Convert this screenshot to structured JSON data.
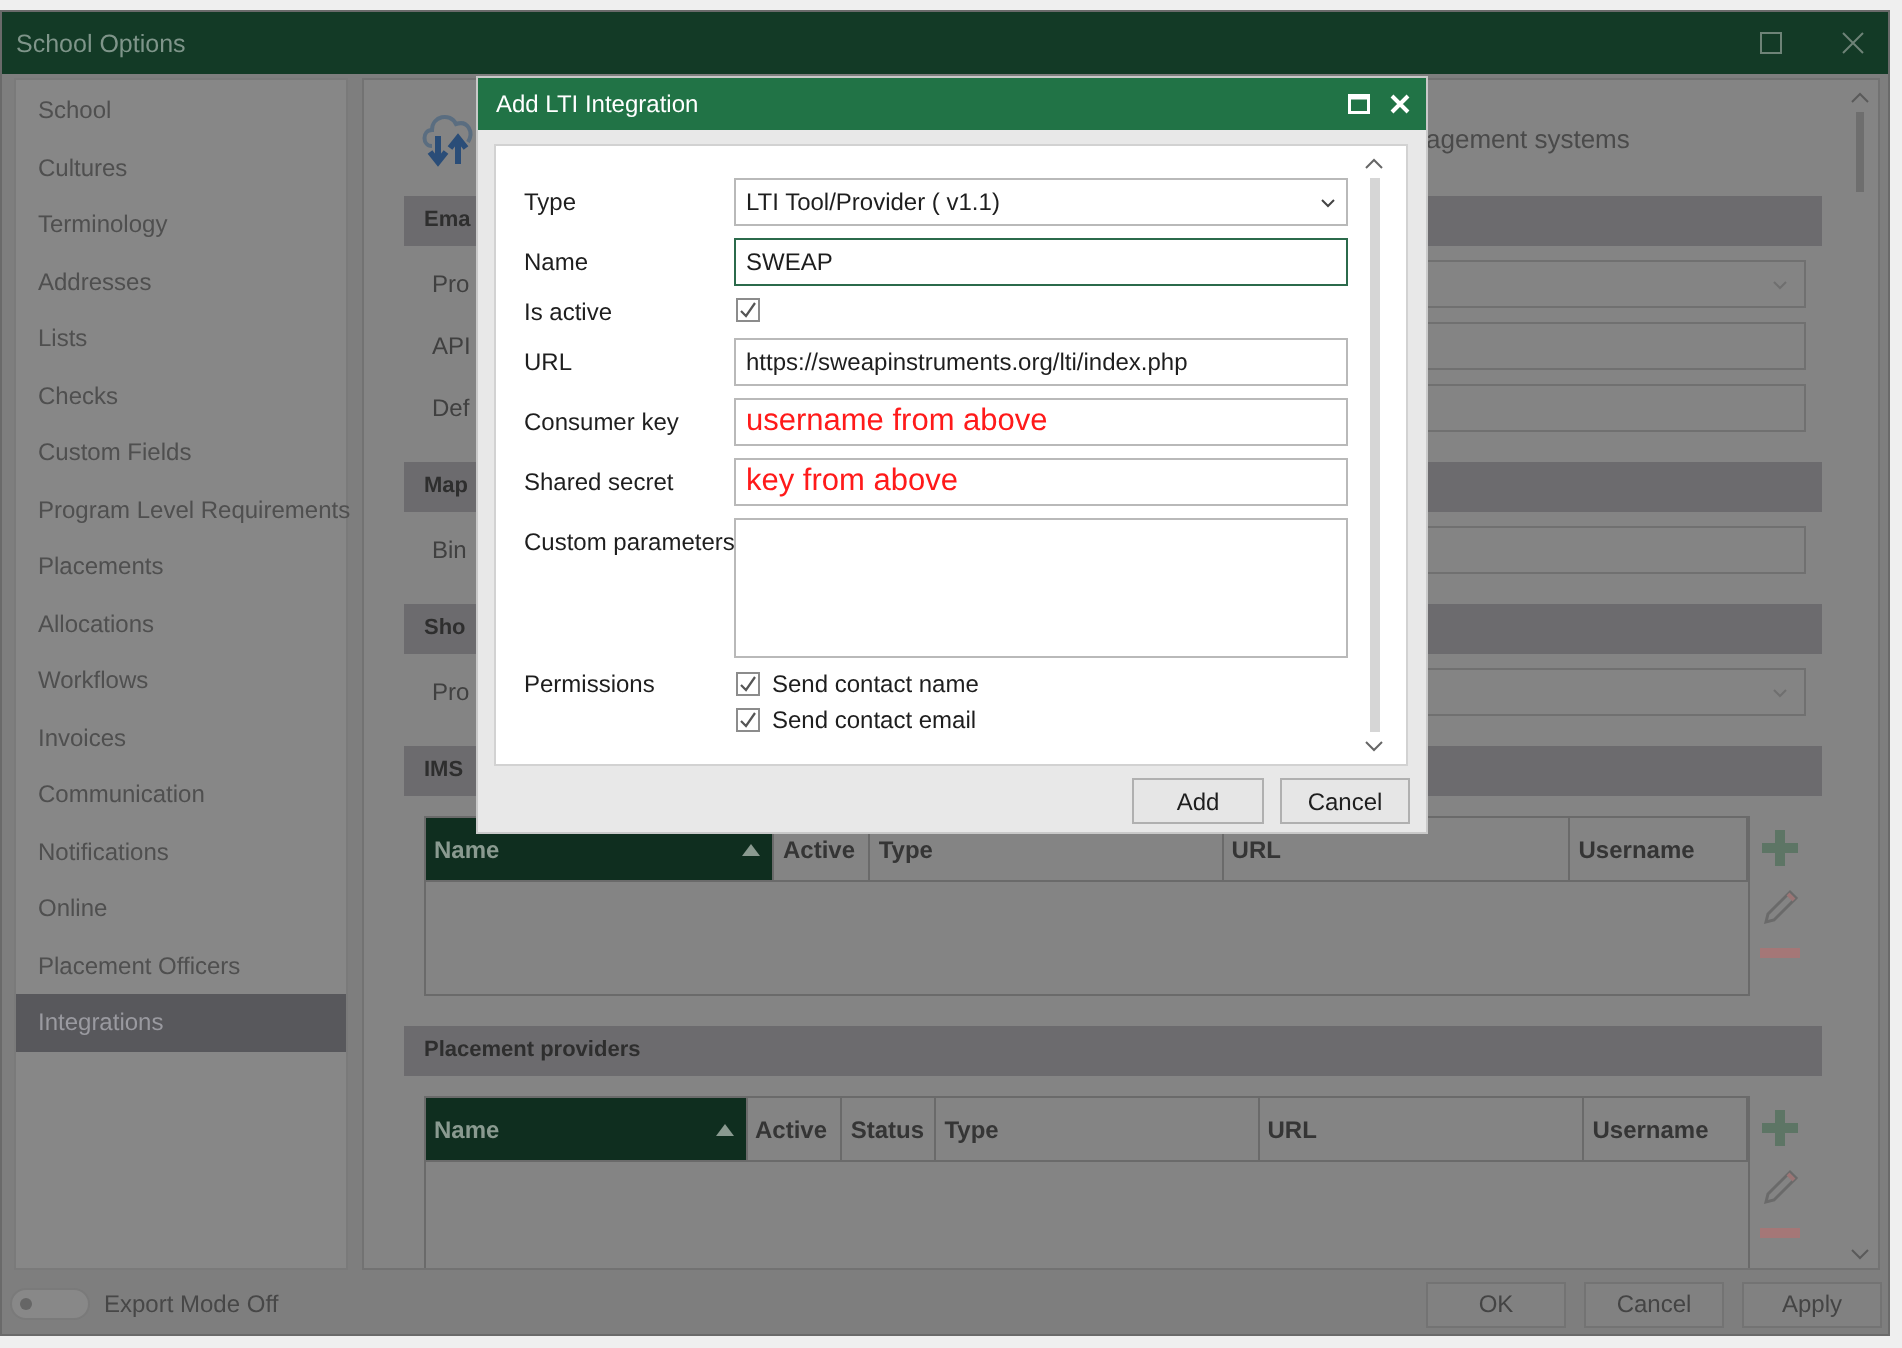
{
  "window": {
    "title": "School Options"
  },
  "sidebar": {
    "items": [
      {
        "label": "School",
        "selected": false
      },
      {
        "label": "Cultures",
        "selected": false
      },
      {
        "label": "Terminology",
        "selected": false
      },
      {
        "label": "Addresses",
        "selected": false
      },
      {
        "label": "Lists",
        "selected": false
      },
      {
        "label": "Checks",
        "selected": false
      },
      {
        "label": "Custom Fields",
        "selected": false
      },
      {
        "label": "Program Level Requirements",
        "selected": false
      },
      {
        "label": "Placements",
        "selected": false
      },
      {
        "label": "Allocations",
        "selected": false
      },
      {
        "label": "Workflows",
        "selected": false
      },
      {
        "label": "Invoices",
        "selected": false
      },
      {
        "label": "Communication",
        "selected": false
      },
      {
        "label": "Notifications",
        "selected": false
      },
      {
        "label": "Online",
        "selected": false
      },
      {
        "label": "Placement Officers",
        "selected": false
      },
      {
        "label": "Integrations",
        "selected": true
      }
    ]
  },
  "content": {
    "heading": "agement systems",
    "blocks": [
      {
        "kind": "section",
        "title": "Ema"
      },
      {
        "kind": "dropdown",
        "label": "Pro"
      },
      {
        "kind": "textfield",
        "label": "API"
      },
      {
        "kind": "textfield",
        "label": "Def"
      },
      {
        "kind": "section",
        "title": "Map"
      },
      {
        "kind": "textfield",
        "label": "Bin"
      },
      {
        "kind": "section",
        "title": "Sho"
      },
      {
        "kind": "dropdown",
        "label": "Pro"
      },
      {
        "kind": "section",
        "title": "IMS"
      },
      {
        "kind": "table",
        "columns": [
          {
            "label": "Name",
            "sorted": true
          },
          {
            "label": "Active",
            "sorted": false
          },
          {
            "label": "Type",
            "sorted": false
          },
          {
            "label": "URL",
            "sorted": false
          },
          {
            "label": "Username",
            "sorted": false
          }
        ]
      },
      {
        "kind": "section",
        "title": "Placement providers"
      },
      {
        "kind": "table",
        "columns": [
          {
            "label": "Name",
            "sorted": true
          },
          {
            "label": "Active",
            "sorted": false
          },
          {
            "label": "Status",
            "sorted": false
          },
          {
            "label": "Type",
            "sorted": false
          },
          {
            "label": "URL",
            "sorted": false
          },
          {
            "label": "Username",
            "sorted": false
          }
        ]
      }
    ]
  },
  "footer": {
    "export_mode": {
      "label": "Export Mode Off",
      "on": false
    },
    "buttons": [
      "OK",
      "Cancel",
      "Apply"
    ]
  },
  "dialog": {
    "title": "Add LTI Integration",
    "rows": [
      {
        "label": "Type",
        "kind": "dropdown",
        "value": "LTI Tool/Provider ( v1.1)",
        "focused": false
      },
      {
        "label": "Name",
        "kind": "text",
        "value": "SWEAP",
        "focused": true,
        "annotated": false
      },
      {
        "label": "Is active",
        "kind": "checkbox",
        "checked": true
      },
      {
        "label": "URL",
        "kind": "text",
        "value": "https://sweapinstruments.org/lti/index.php",
        "focused": false,
        "annotated": false
      },
      {
        "label": "Consumer key",
        "kind": "text",
        "value": "username from above",
        "focused": false,
        "annotated": true
      },
      {
        "label": "Shared secret",
        "kind": "text",
        "value": "key from above",
        "focused": false,
        "annotated": true
      },
      {
        "label": "Custom parameters",
        "kind": "textarea",
        "focused": false
      },
      {
        "label": "Permissions",
        "kind": "checklist",
        "options": [
          {
            "label": "Send contact name",
            "checked": true
          },
          {
            "label": "Send contact email",
            "checked": true
          }
        ]
      }
    ],
    "buttons": [
      "Add",
      "Cancel"
    ]
  }
}
